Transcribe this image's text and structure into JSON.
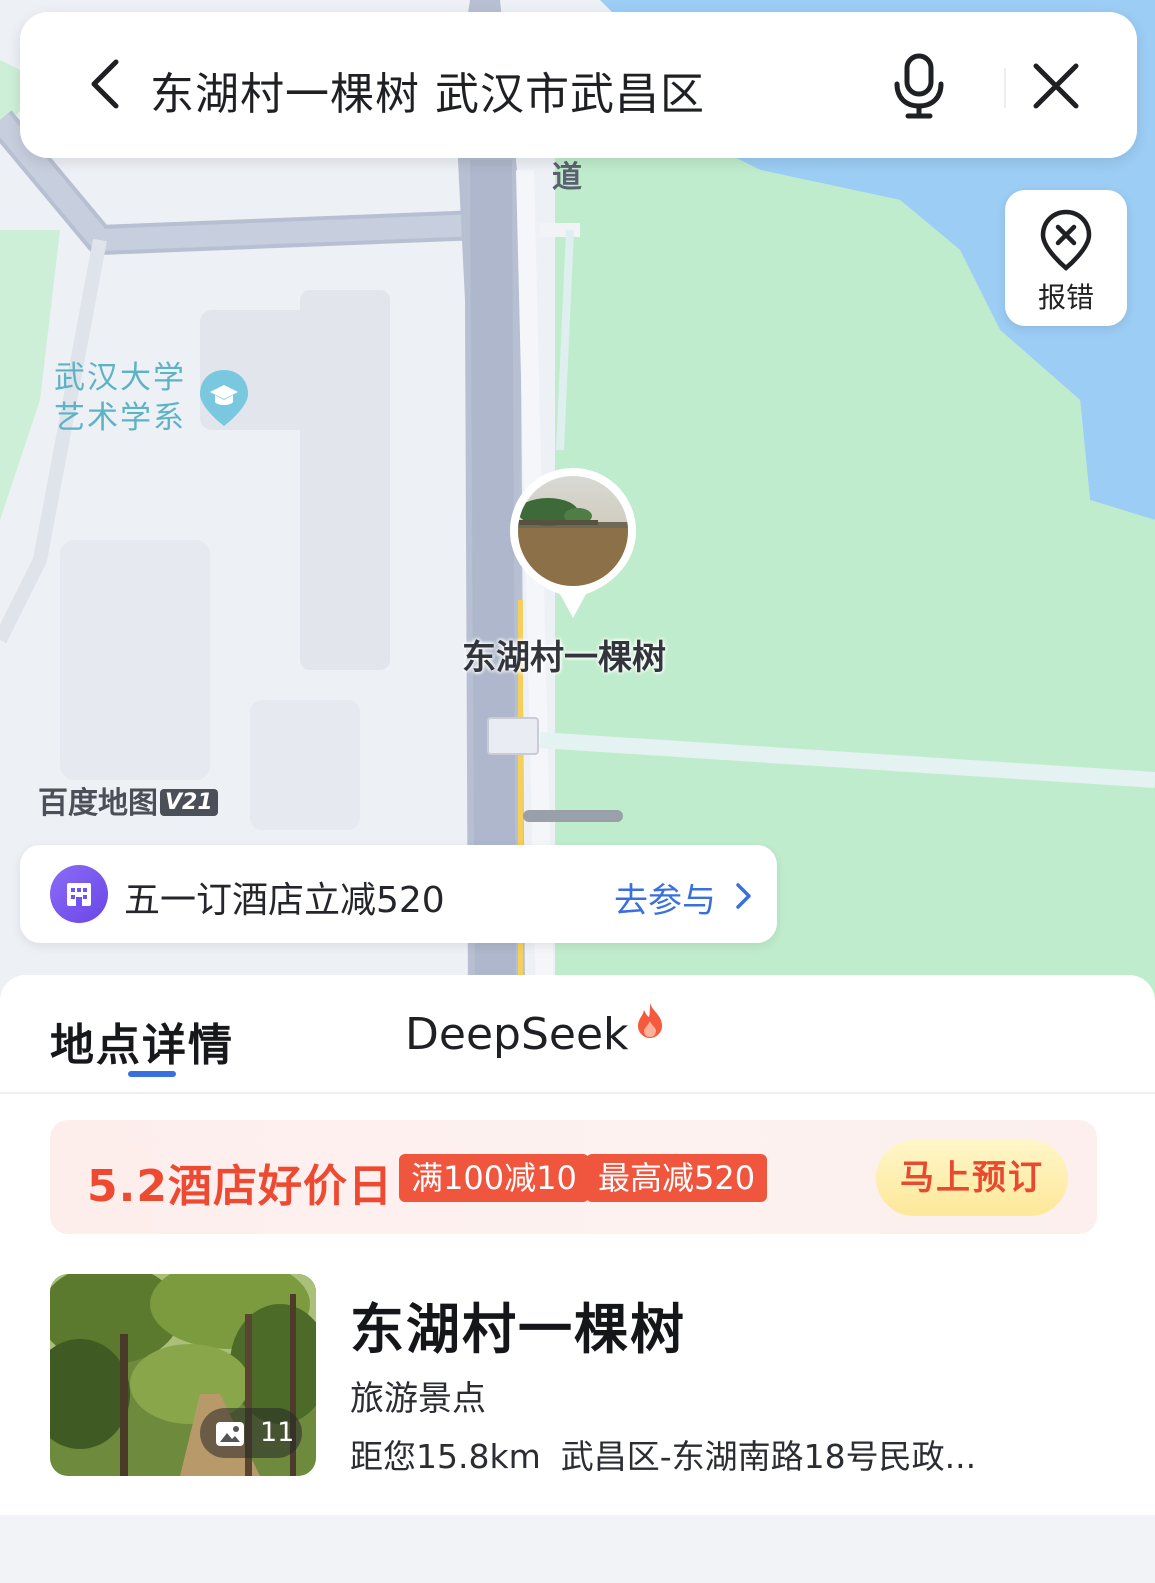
{
  "search": {
    "query": "东湖村一棵树 武汉市武昌区"
  },
  "map": {
    "report_error_label": "报错",
    "road_char": "道",
    "poi_school_label_line1": "武汉大学",
    "poi_school_label_line2": "艺术学系",
    "pin_label": "东湖村一棵树",
    "brand": "百度地图",
    "brand_version": "V21",
    "colors": {
      "park": "#bfeccc",
      "water": "#9ccdf5",
      "road": "#b7bfd2",
      "land": "#edf0f5"
    }
  },
  "promo_banner": {
    "text": "五一订酒店立减520",
    "cta": "去参与"
  },
  "tabs": [
    {
      "label": "地点详情",
      "active": true
    },
    {
      "label": "DeepSeek",
      "active": false
    }
  ],
  "deal": {
    "title": "5.2酒店好价日",
    "tag1": "满100减10",
    "tag2": "最高减520",
    "book_label": "马上预订"
  },
  "place": {
    "name": "东湖村一棵树",
    "category": "旅游景点",
    "distance": "距您15.8km",
    "address": "武昌区-东湖南路18号民政...",
    "photo_count": "11"
  },
  "accent_color": "#3a6fe0"
}
